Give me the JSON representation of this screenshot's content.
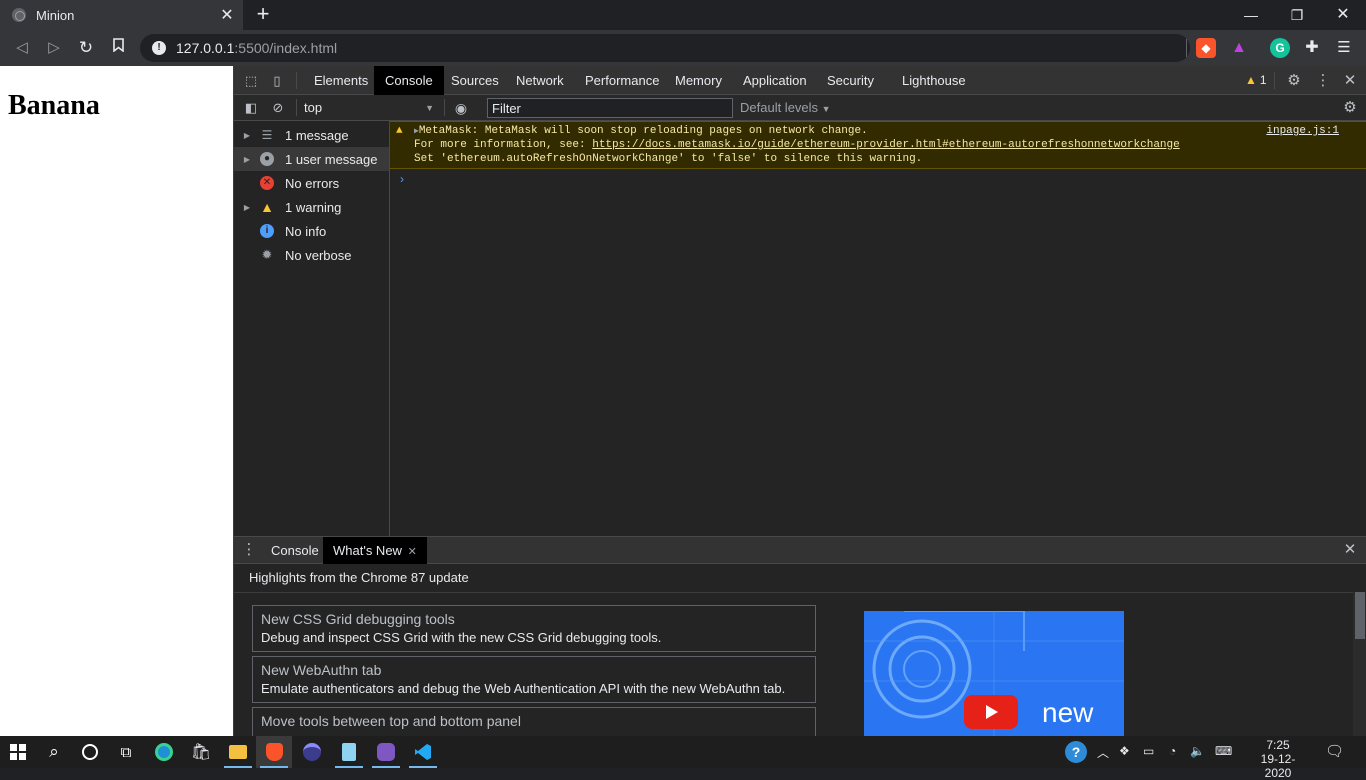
{
  "browser": {
    "tab_title": "Minion",
    "url_host": "127.0.0.1",
    "url_path": ":5500/index.html",
    "new_tab_label": "+"
  },
  "page": {
    "heading": "Banana"
  },
  "devtools": {
    "tabs": [
      "Elements",
      "Console",
      "Sources",
      "Network",
      "Performance",
      "Memory",
      "Application",
      "Security",
      "Lighthouse"
    ],
    "active_tab": "Console",
    "warning_count": "1",
    "context": "top",
    "filter_placeholder": "Filter",
    "levels_label": "Default levels",
    "sidebar": [
      {
        "label": "1 message",
        "icon": "list-icon",
        "expandable": true
      },
      {
        "label": "1 user message",
        "icon": "user-icon",
        "expandable": true,
        "selected": true
      },
      {
        "label": "No errors",
        "icon": "error-icon",
        "expandable": false
      },
      {
        "label": "1 warning",
        "icon": "warning-icon",
        "expandable": true
      },
      {
        "label": "No info",
        "icon": "info-icon",
        "expandable": false
      },
      {
        "label": "No verbose",
        "icon": "bug-icon",
        "expandable": false
      }
    ],
    "warning_message": {
      "line1": "MetaMask: MetaMask will soon stop reloading pages on network change.",
      "line2_prefix": "For more information, see: ",
      "line2_link": "https://docs.metamask.io/guide/ethereum-provider.html#ethereum-autorefreshonnetworkchange",
      "line3": "Set 'ethereum.autoRefreshOnNetworkChange' to 'false' to silence this warning.",
      "source": "inpage.js:1"
    },
    "drawer": {
      "tabs": [
        "Console",
        "What's New"
      ],
      "active_tab": "What's New",
      "highlights": "Highlights from the Chrome 87 update",
      "cards": [
        {
          "title": "New CSS Grid debugging tools",
          "desc": "Debug and inspect CSS Grid with the new CSS Grid debugging tools."
        },
        {
          "title": "New WebAuthn tab",
          "desc": "Emulate authenticators and debug the Web Authentication API with the new WebAuthn tab."
        },
        {
          "title": "Move tools between top and bottom panel",
          "desc": ""
        }
      ],
      "video_label": "new"
    }
  },
  "taskbar": {
    "time": "7:25",
    "date": "19-12-2020"
  },
  "colors": {
    "accent_blue": "#4d9efe",
    "warning_yellow": "#f9c530",
    "error_red": "#e84133",
    "video_blue": "#2a76f2"
  }
}
